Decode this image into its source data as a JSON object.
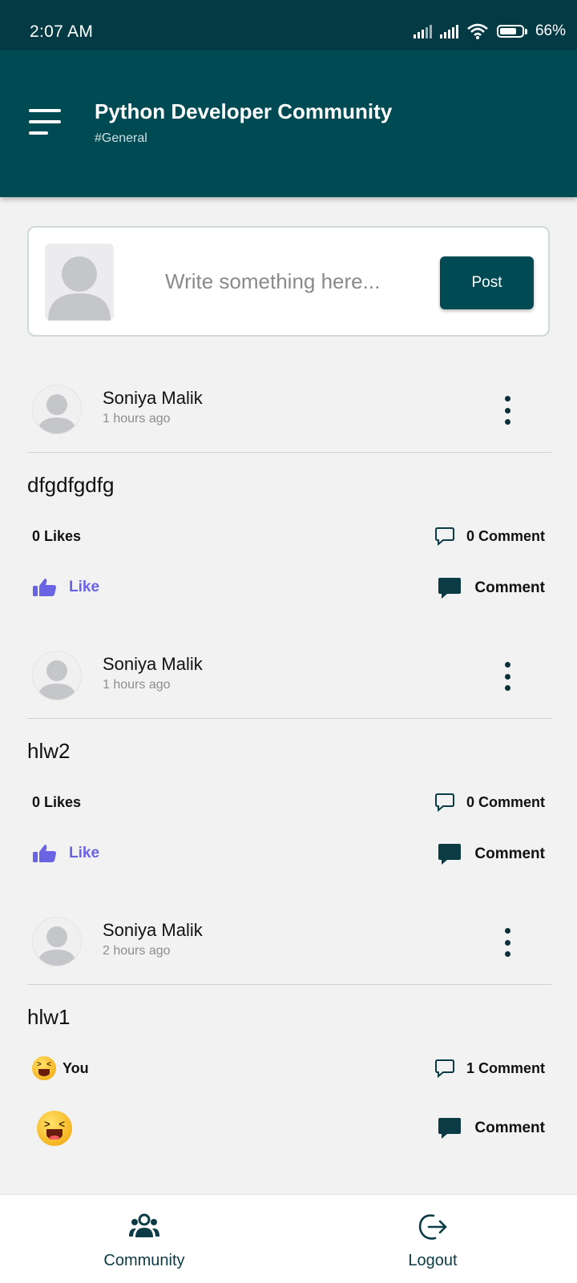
{
  "status": {
    "time": "2:07 AM",
    "battery": "66%"
  },
  "header": {
    "title": "Python Developer Community",
    "subtitle": "#General"
  },
  "composer": {
    "placeholder": "Write something here...",
    "post_label": "Post"
  },
  "posts": [
    {
      "author": "Soniya Malik",
      "time": "1 hours ago",
      "text": "dfgdfgdfg",
      "likes": "0 Likes",
      "comments": "0 Comment",
      "like_label": "Like",
      "comment_label": "Comment"
    },
    {
      "author": "Soniya Malik",
      "time": "1 hours ago",
      "text": "hlw2",
      "likes": "0 Likes",
      "comments": "0 Comment",
      "like_label": "Like",
      "comment_label": "Comment"
    },
    {
      "author": "Soniya Malik",
      "time": "2 hours ago",
      "text": "hlw1",
      "likes": "You",
      "comments": "1 Comment",
      "comment_label": "Comment"
    }
  ],
  "nav": [
    {
      "label": "Community"
    },
    {
      "label": "Logout"
    }
  ],
  "colors": {
    "primary": "#004a54",
    "statusbar": "#043a44",
    "like": "#6a63e4",
    "background": "#f2f2f3"
  }
}
